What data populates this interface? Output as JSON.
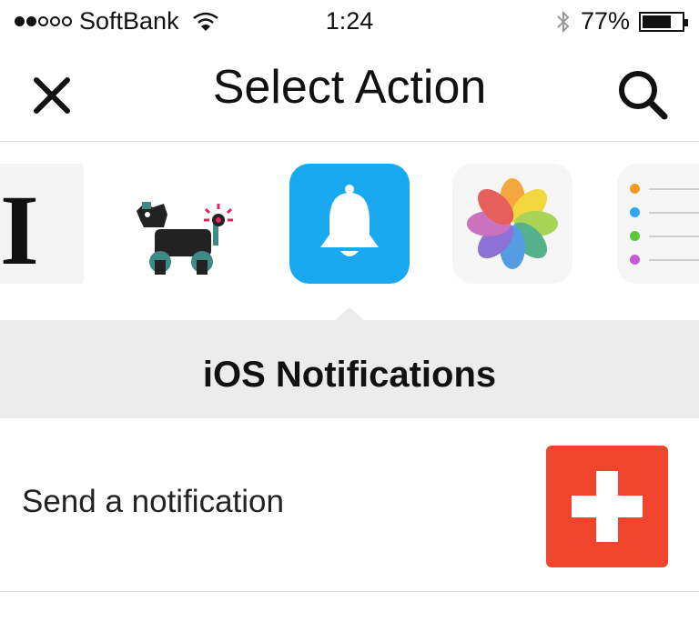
{
  "status_bar": {
    "carrier": "SoftBank",
    "signal_bars": 2,
    "signal_total": 5,
    "time": "1:24",
    "battery_percent": "77%",
    "battery_level": 0.77,
    "icons": [
      "signal-dots-icon",
      "wifi-icon",
      "bluetooth-icon",
      "battery-icon"
    ]
  },
  "nav": {
    "title": "Select Action",
    "left_icon": "close-icon",
    "right_icon": "search-icon"
  },
  "services": [
    {
      "icon": "instapaper-icon",
      "selected": false
    },
    {
      "icon": "robot-dog-icon",
      "selected": false
    },
    {
      "icon": "bell-notification-icon",
      "selected": true,
      "color": "#18a9f0"
    },
    {
      "icon": "photos-flower-icon",
      "selected": false
    },
    {
      "icon": "reminders-icon",
      "selected": false
    }
  ],
  "selected_service": {
    "title": "iOS Notifications"
  },
  "actions": [
    {
      "label": "Send a notification",
      "button_icon": "plus-icon",
      "button_color": "#f0452d"
    }
  ]
}
